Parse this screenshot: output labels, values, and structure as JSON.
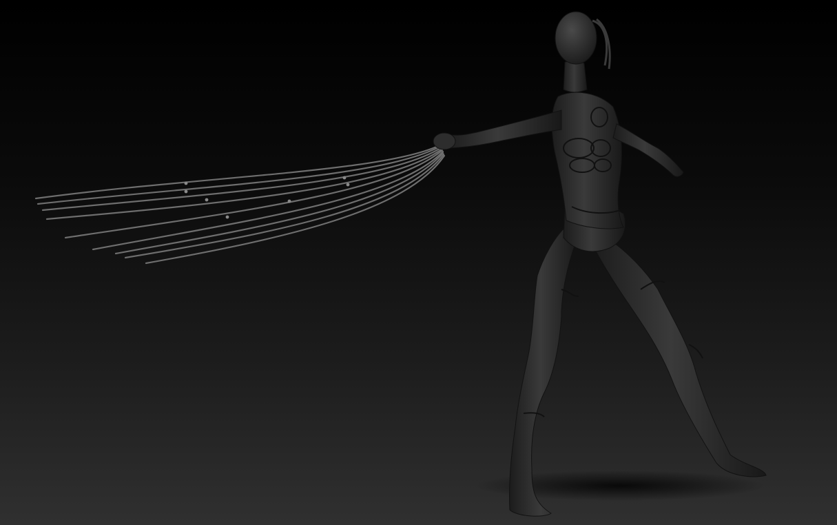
{
  "scene": {
    "subject": "sculpted-figure-with-whip",
    "colors": {
      "background_top": "#000000",
      "background_bottom": "#303030",
      "body": "#2a2a2a",
      "body_highlight": "#4a4a4a",
      "seam": "#141414",
      "whip_strand": "#6e6e6e",
      "shadow": "#050505"
    }
  }
}
